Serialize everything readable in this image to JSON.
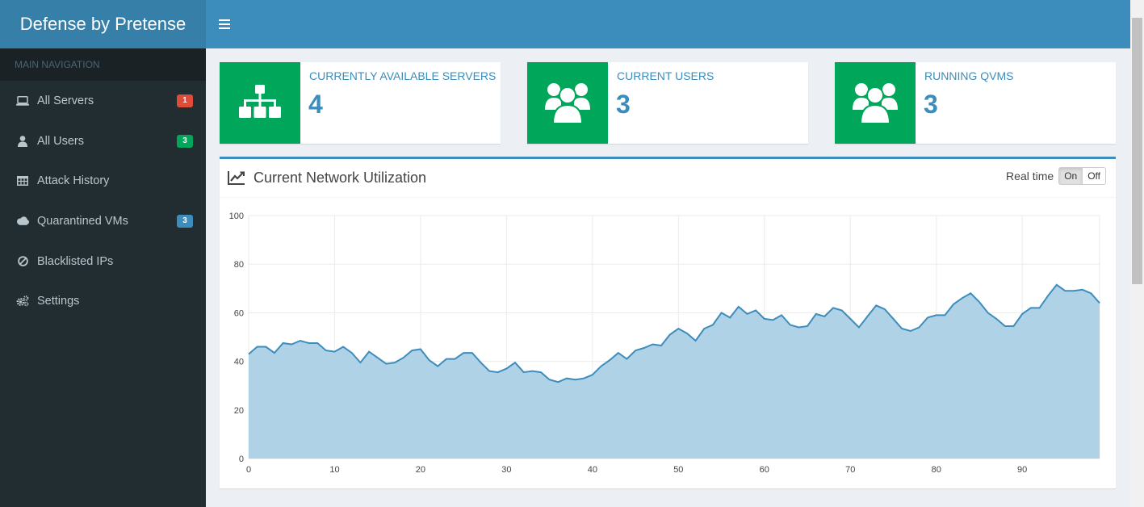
{
  "app": {
    "title": "Defense by Pretense"
  },
  "sidebar": {
    "header": "MAIN NAVIGATION",
    "items": [
      {
        "label": "All Servers",
        "icon": "laptop-icon",
        "badge": "1",
        "badge_color": "#dd4b39"
      },
      {
        "label": "All Users",
        "icon": "user-icon",
        "badge": "3",
        "badge_color": "#00a65a"
      },
      {
        "label": "Attack History",
        "icon": "table-icon"
      },
      {
        "label": "Quarantined VMs",
        "icon": "cloud-icon",
        "badge": "3",
        "badge_color": "#3c8dbc"
      },
      {
        "label": "Blacklisted IPs",
        "icon": "ban-icon"
      },
      {
        "label": "Settings",
        "icon": "cogs-icon"
      }
    ]
  },
  "info_boxes": [
    {
      "title": "CURRENTLY AVAILABLE SERVERS",
      "value": "4",
      "icon": "sitemap-icon"
    },
    {
      "title": "CURRENT USERS",
      "value": "3",
      "icon": "users-icon"
    },
    {
      "title": "RUNNING QVMS",
      "value": "3",
      "icon": "users-icon"
    }
  ],
  "chart_box": {
    "title": "Current Network Utilization",
    "realtime_label": "Real time",
    "on_label": "On",
    "off_label": "Off",
    "active": "On"
  },
  "colors": {
    "accent": "#3c8dbc",
    "green": "#00a65a",
    "sidebar": "#222d32",
    "area_fill": "#afd2e6"
  },
  "chart_data": {
    "type": "area",
    "title": "",
    "xlabel": "",
    "ylabel": "",
    "xlim": [
      0,
      99
    ],
    "ylim": [
      0,
      100
    ],
    "x_ticks": [
      0,
      10,
      20,
      30,
      40,
      50,
      60,
      70,
      80,
      90
    ],
    "y_ticks": [
      0,
      20,
      40,
      60,
      80,
      100
    ],
    "grid": true,
    "series": [
      {
        "x_start": 0,
        "values": [
          43,
          46,
          46,
          43.5,
          47.5,
          47,
          48.5,
          47.5,
          47.5,
          44.5,
          44,
          46,
          43.5,
          39.5,
          44,
          41.5,
          39,
          39.5,
          41.5,
          44.5,
          45,
          40.5,
          38,
          41,
          41,
          43.5,
          43.5,
          39.5,
          36,
          35.5,
          37,
          39.5,
          35.5,
          36,
          35.5,
          32.5,
          31.5,
          33,
          32.5,
          33,
          34.5,
          38,
          40.5,
          43.5,
          41,
          44.5,
          45.5,
          47,
          46.5,
          51,
          53.5,
          51.5,
          48.5,
          53.5,
          55,
          60,
          58,
          62.5,
          59.5,
          61,
          57.5,
          57,
          59,
          55,
          54,
          54.5,
          59.5,
          58.5,
          62,
          61,
          57.5,
          54,
          58.5,
          63,
          61.5,
          57.5,
          53.5,
          52.5,
          54,
          58,
          59,
          59,
          63.5,
          66,
          68,
          64.5,
          60,
          57.5,
          54.5,
          54.5,
          59.5,
          62,
          62,
          67,
          71.5,
          69,
          69,
          69.5,
          68,
          64
        ]
      }
    ]
  }
}
